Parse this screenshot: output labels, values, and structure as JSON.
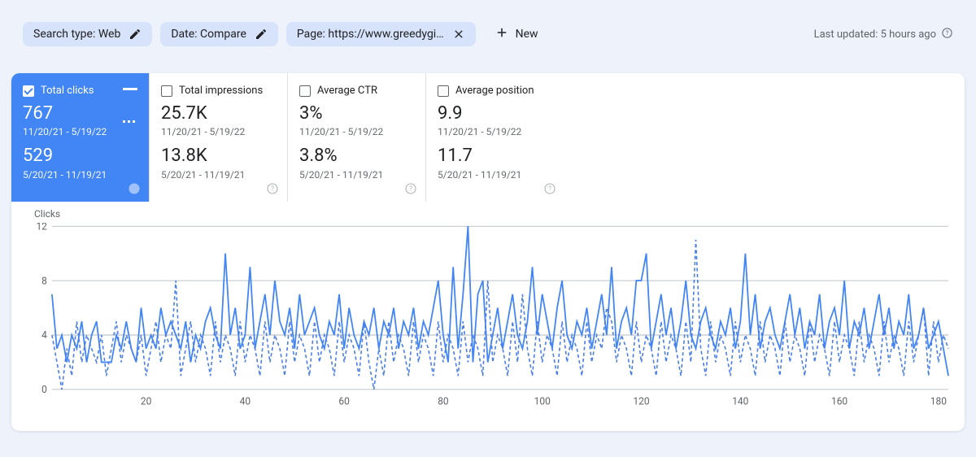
{
  "topbar": {
    "chips": {
      "searchType": "Search type: Web",
      "date": "Date: Compare",
      "page": "Page: https://www.greedygi…",
      "newLabel": "New"
    },
    "lastUpdated": "Last updated: 5 hours ago"
  },
  "metrics": [
    {
      "id": "clicks",
      "label": "Total clicks",
      "checked": true,
      "v1": "767",
      "r1": "11/20/21 - 5/19/22",
      "v2": "529",
      "r2": "5/20/21 - 11/19/21"
    },
    {
      "id": "impr",
      "label": "Total impressions",
      "checked": false,
      "v1": "25.7K",
      "r1": "11/20/21 - 5/19/22",
      "v2": "13.8K",
      "r2": "5/20/21 - 11/19/21"
    },
    {
      "id": "ctr",
      "label": "Average CTR",
      "checked": false,
      "v1": "3%",
      "r1": "11/20/21 - 5/19/22",
      "v2": "3.8%",
      "r2": "5/20/21 - 11/19/21"
    },
    {
      "id": "pos",
      "label": "Average position",
      "checked": false,
      "v1": "9.9",
      "r1": "11/20/21 - 5/19/22",
      "v2": "11.7",
      "r2": "5/20/21 - 11/19/21"
    }
  ],
  "chart_data": {
    "type": "line",
    "title": "",
    "ylabel": "Clicks",
    "xlabel": "",
    "ylim": [
      0,
      12
    ],
    "y_ticks": [
      0,
      4,
      8,
      12
    ],
    "x_ticks": [
      20,
      40,
      60,
      80,
      100,
      120,
      140,
      160,
      180
    ],
    "x": [
      1,
      2,
      3,
      4,
      5,
      6,
      7,
      8,
      9,
      10,
      11,
      12,
      13,
      14,
      15,
      16,
      17,
      18,
      19,
      20,
      21,
      22,
      23,
      24,
      25,
      26,
      27,
      28,
      29,
      30,
      31,
      32,
      33,
      34,
      35,
      36,
      37,
      38,
      39,
      40,
      41,
      42,
      43,
      44,
      45,
      46,
      47,
      48,
      49,
      50,
      51,
      52,
      53,
      54,
      55,
      56,
      57,
      58,
      59,
      60,
      61,
      62,
      63,
      64,
      65,
      66,
      67,
      68,
      69,
      70,
      71,
      72,
      73,
      74,
      75,
      76,
      77,
      78,
      79,
      80,
      81,
      82,
      83,
      84,
      85,
      86,
      87,
      88,
      89,
      90,
      91,
      92,
      93,
      94,
      95,
      96,
      97,
      98,
      99,
      100,
      101,
      102,
      103,
      104,
      105,
      106,
      107,
      108,
      109,
      110,
      111,
      112,
      113,
      114,
      115,
      116,
      117,
      118,
      119,
      120,
      121,
      122,
      123,
      124,
      125,
      126,
      127,
      128,
      129,
      130,
      131,
      132,
      133,
      134,
      135,
      136,
      137,
      138,
      139,
      140,
      141,
      142,
      143,
      144,
      145,
      146,
      147,
      148,
      149,
      150,
      151,
      152,
      153,
      154,
      155,
      156,
      157,
      158,
      159,
      160,
      161,
      162,
      163,
      164,
      165,
      166,
      167,
      168,
      169,
      170,
      171,
      172,
      173,
      174,
      175,
      176,
      177,
      178,
      179,
      180,
      181,
      182
    ],
    "series": [
      {
        "name": "11/20/21 - 5/19/22",
        "style": "solid",
        "values": [
          7,
          3,
          4,
          2,
          4,
          3,
          5,
          2,
          4,
          5,
          2,
          2,
          2,
          4,
          3,
          5,
          3,
          2,
          6,
          3,
          4,
          3,
          6,
          4,
          5,
          4,
          3,
          5,
          2,
          4,
          3,
          5,
          6,
          4,
          3,
          10,
          4,
          6,
          3,
          4,
          9,
          3,
          5,
          7,
          4,
          8,
          5,
          4,
          6,
          3,
          7,
          4,
          5,
          6,
          4,
          3,
          5,
          4,
          7,
          3,
          6,
          4,
          3,
          5,
          4,
          6,
          3,
          5,
          4,
          6,
          3,
          5,
          4,
          6,
          3,
          5,
          4,
          6,
          8,
          4,
          2,
          9,
          3,
          7,
          12,
          2,
          7,
          8,
          2,
          4,
          6,
          3,
          5,
          7,
          4,
          3,
          5,
          9,
          4,
          7,
          5,
          3,
          6,
          8,
          4,
          3,
          5,
          4,
          6,
          3,
          5,
          7,
          4,
          9,
          3,
          5,
          6,
          4,
          8,
          8,
          10,
          3,
          5,
          7,
          4,
          6,
          3,
          5,
          8,
          4,
          3,
          5,
          6,
          4,
          3,
          5,
          4,
          6,
          3,
          5,
          10,
          4,
          7,
          3,
          5,
          6,
          4,
          3,
          5,
          7,
          4,
          6,
          3,
          5,
          4,
          7,
          3,
          5,
          6,
          4,
          8,
          3,
          5,
          4,
          6,
          3,
          5,
          7,
          4,
          6,
          3,
          5,
          4,
          7,
          3,
          4,
          6,
          3,
          4,
          5,
          3,
          1
        ]
      },
      {
        "name": "5/20/21 - 11/19/21",
        "style": "dashed",
        "values": [
          4,
          2,
          0,
          3,
          1,
          5,
          2,
          4,
          3,
          2,
          4,
          1,
          3,
          5,
          2,
          4,
          3,
          2,
          4,
          1,
          3,
          5,
          2,
          4,
          3,
          8,
          1,
          3,
          5,
          2,
          4,
          3,
          1,
          5,
          2,
          4,
          3,
          1,
          5,
          2,
          4,
          3,
          1,
          5,
          2,
          4,
          3,
          1,
          5,
          2,
          4,
          3,
          1,
          5,
          2,
          4,
          3,
          1,
          5,
          2,
          4,
          3,
          1,
          5,
          2,
          0,
          3,
          1,
          5,
          2,
          4,
          3,
          1,
          5,
          2,
          4,
          3,
          1,
          5,
          2,
          4,
          3,
          1,
          5,
          2,
          4,
          3,
          1,
          8,
          2,
          4,
          3,
          1,
          5,
          2,
          7,
          3,
          1,
          5,
          2,
          4,
          3,
          1,
          5,
          2,
          4,
          3,
          1,
          5,
          2,
          4,
          3,
          6,
          5,
          2,
          4,
          3,
          1,
          5,
          2,
          4,
          3,
          1,
          5,
          2,
          4,
          3,
          1,
          5,
          2,
          11,
          3,
          1,
          5,
          2,
          4,
          3,
          1,
          5,
          2,
          4,
          3,
          1,
          5,
          2,
          4,
          3,
          1,
          5,
          2,
          4,
          3,
          1,
          5,
          2,
          4,
          3,
          1,
          5,
          2,
          4,
          3,
          1,
          5,
          2,
          4,
          3,
          1,
          5,
          2,
          4,
          3,
          1,
          5,
          2,
          4,
          6,
          1,
          5,
          2,
          4,
          3
        ]
      }
    ]
  }
}
